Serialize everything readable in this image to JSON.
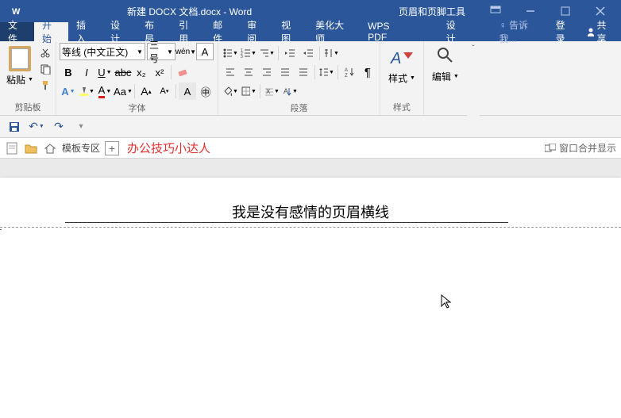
{
  "title": "新建 DOCX 文档.docx - Word",
  "tools_title": "页眉和页脚工具",
  "tabs": {
    "file": "文件",
    "home": "开始",
    "insert": "插入",
    "design": "设计",
    "layout": "布局",
    "references": "引用",
    "mail": "邮件",
    "review": "审阅",
    "view": "视图",
    "beautify": "美化大师",
    "wps": "WPS PDF",
    "hf_design": "设计"
  },
  "tell_me": "告诉我...",
  "login": "登录",
  "share": "共享",
  "clipboard": {
    "paste": "粘贴",
    "label": "剪贴板"
  },
  "font": {
    "name": "等线 (中文正文)",
    "size": "三号",
    "label": "字体"
  },
  "paragraph": {
    "label": "段落"
  },
  "styles": {
    "btn": "样式",
    "label": "样式"
  },
  "editing": {
    "btn": "编辑"
  },
  "tabbar": {
    "template": "模板专区",
    "title": "办公技巧小达人",
    "merge": "窗口合并显示"
  },
  "doc": {
    "header_text": "我是没有感情的页眉横线"
  }
}
